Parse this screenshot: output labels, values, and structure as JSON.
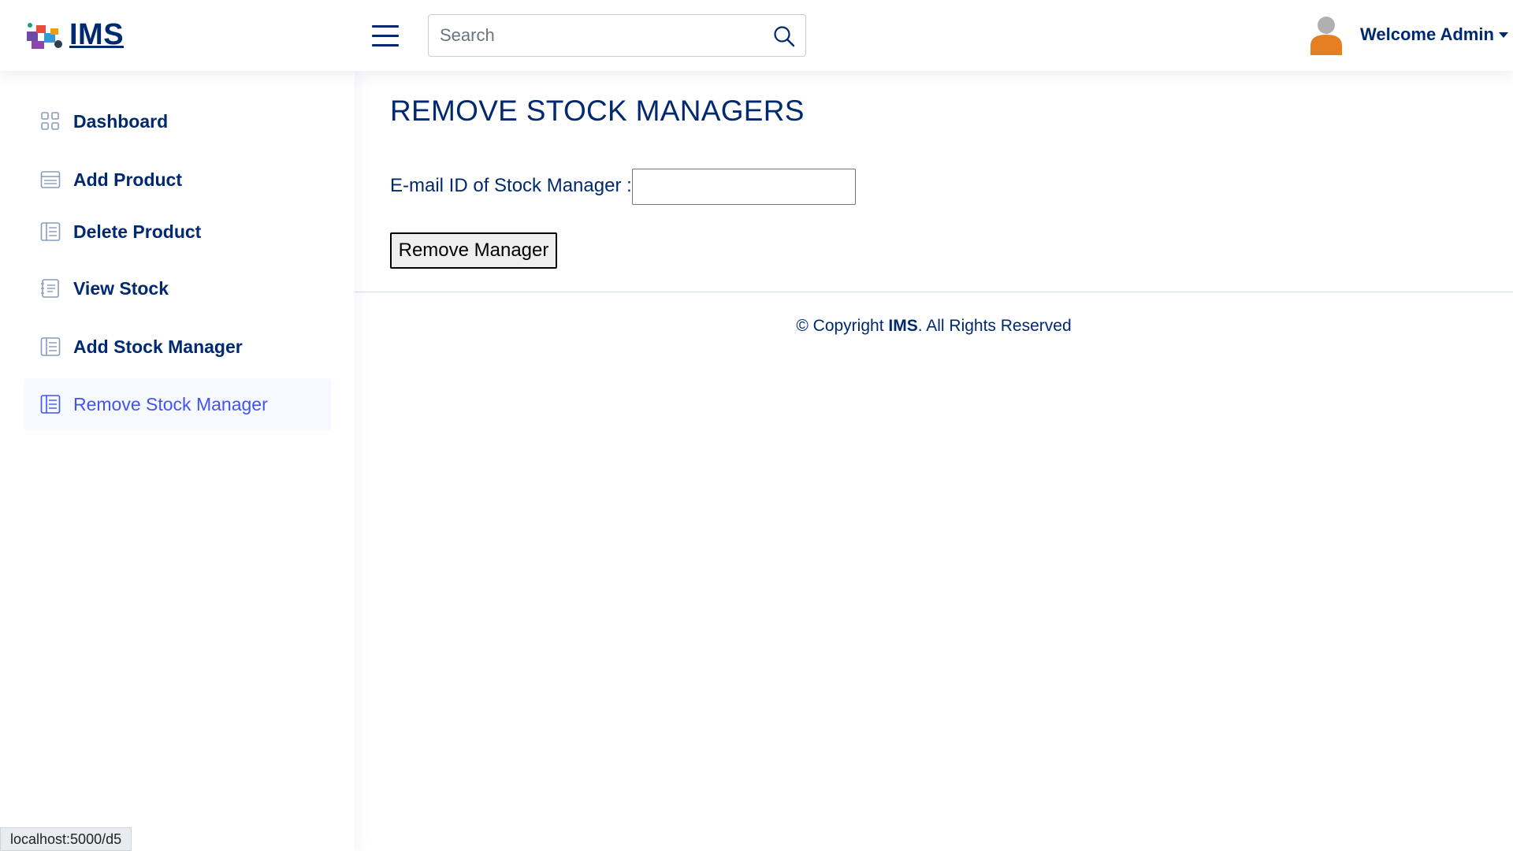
{
  "header": {
    "logo_text": "IMS",
    "search_placeholder": "Search",
    "welcome_text": "Welcome Admin"
  },
  "sidebar": {
    "items": [
      {
        "label": "Dashboard",
        "icon": "grid-icon"
      },
      {
        "label": "Add Product",
        "icon": "layout-text-window-icon"
      },
      {
        "label": "Delete Product",
        "icon": "layout-text-sidebar-icon"
      },
      {
        "label": "View Stock",
        "icon": "journal-text-icon"
      },
      {
        "label": "Add Stock Manager",
        "icon": "layout-text-sidebar-icon"
      },
      {
        "label": "Remove Stock Manager",
        "icon": "layout-text-sidebar-icon",
        "active": true
      }
    ]
  },
  "main": {
    "title": "REMOVE STOCK MANAGERS",
    "email_label": "E-mail ID of Stock Manager :",
    "email_value": "",
    "submit_label": "Remove Manager"
  },
  "footer": {
    "prefix": "© Copyright ",
    "brand": "IMS",
    "suffix": ". All Rights Reserved"
  },
  "statusbar": {
    "url": "localhost:5000/d5"
  },
  "colors": {
    "primary": "#012970",
    "accent": "#4154f1",
    "active_bg": "#f6f9ff",
    "avatar_body": "#e67e22",
    "avatar_head": "#b0b0b0"
  }
}
